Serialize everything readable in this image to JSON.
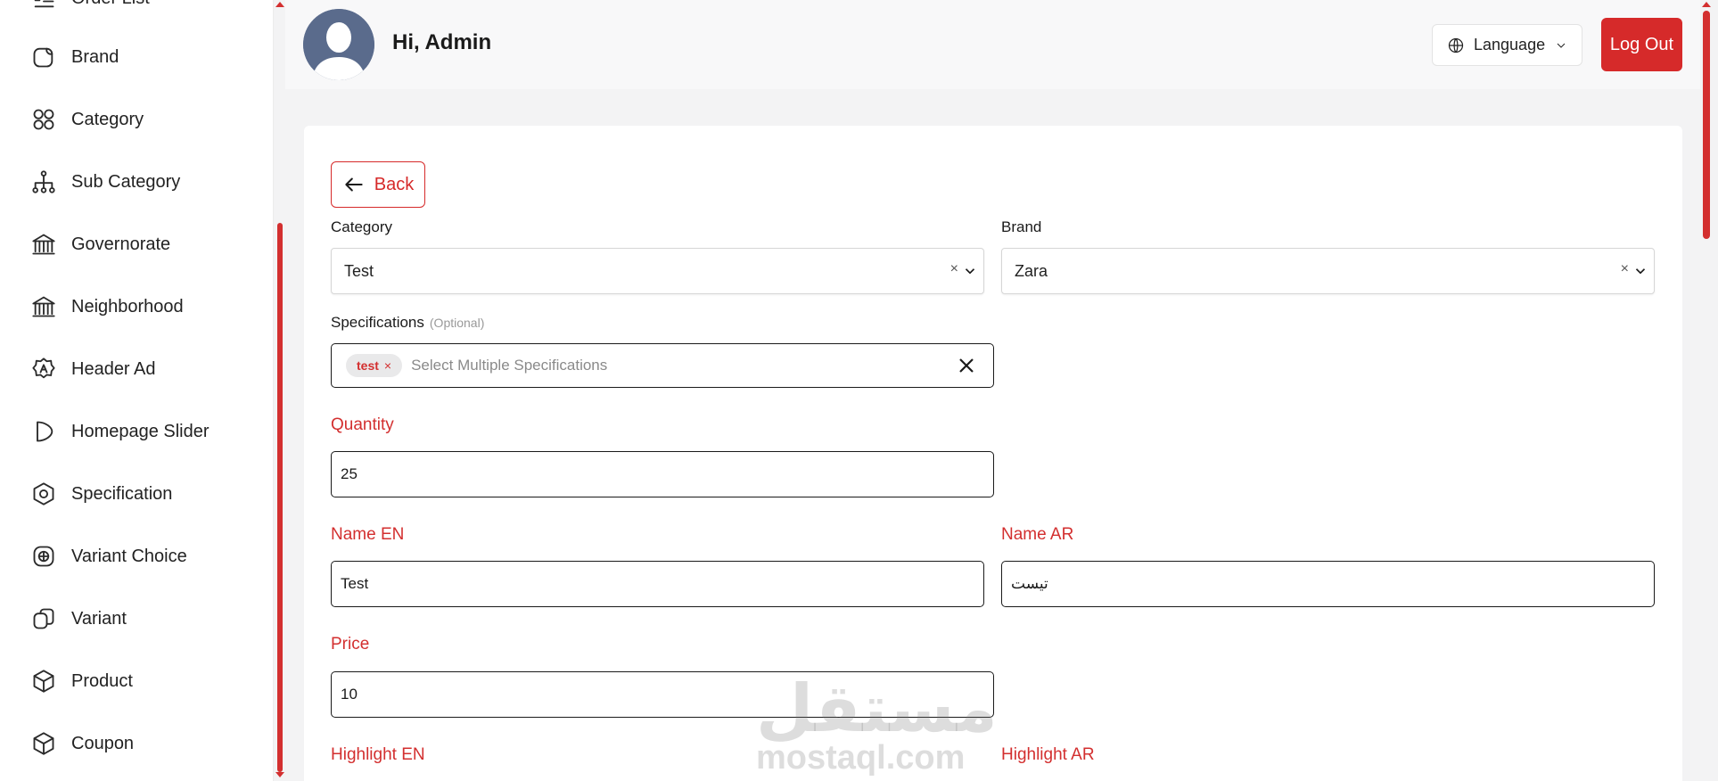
{
  "sidebar": {
    "items": [
      {
        "label": "Order List",
        "icon": "list-icon"
      },
      {
        "label": "Brand",
        "icon": "brand-icon"
      },
      {
        "label": "Category",
        "icon": "category-icon"
      },
      {
        "label": "Sub Category",
        "icon": "sitemap-icon"
      },
      {
        "label": "Governorate",
        "icon": "building-icon"
      },
      {
        "label": "Neighborhood",
        "icon": "building-icon"
      },
      {
        "label": "Header Ad",
        "icon": "ad-badge-icon"
      },
      {
        "label": "Homepage Slider",
        "icon": "slider-icon"
      },
      {
        "label": "Specification",
        "icon": "hexagon-icon"
      },
      {
        "label": "Variant Choice",
        "icon": "plus-square-icon"
      },
      {
        "label": "Variant",
        "icon": "variant-icon"
      },
      {
        "label": "Product",
        "icon": "box-icon"
      },
      {
        "label": "Coupon",
        "icon": "box-icon"
      }
    ]
  },
  "header": {
    "greeting": "Hi, Admin",
    "language_label": "Language",
    "logout_label": "Log Out"
  },
  "form": {
    "back_label": "Back",
    "category": {
      "label": "Category",
      "value": "Test",
      "clear": "×"
    },
    "brand": {
      "label": "Brand",
      "value": "Zara",
      "clear": "×"
    },
    "specifications": {
      "label": "Specifications",
      "optional": "(Optional)",
      "chips": [
        "test"
      ],
      "chip_remove": "×",
      "placeholder": "Select Multiple Specifications"
    },
    "quantity": {
      "label": "Quantity",
      "value": "25"
    },
    "name_en": {
      "label": "Name EN",
      "value": "Test"
    },
    "name_ar": {
      "label": "Name AR",
      "value": "تيست"
    },
    "price": {
      "label": "Price",
      "value": "10"
    },
    "highlight_en": {
      "label": "Highlight EN"
    },
    "highlight_ar": {
      "label": "Highlight AR"
    }
  },
  "watermark": {
    "arabic": "مستقل",
    "latin": "mostaql.com"
  },
  "colors": {
    "accent": "#d62a2a",
    "avatar": "#5a6b8c"
  }
}
